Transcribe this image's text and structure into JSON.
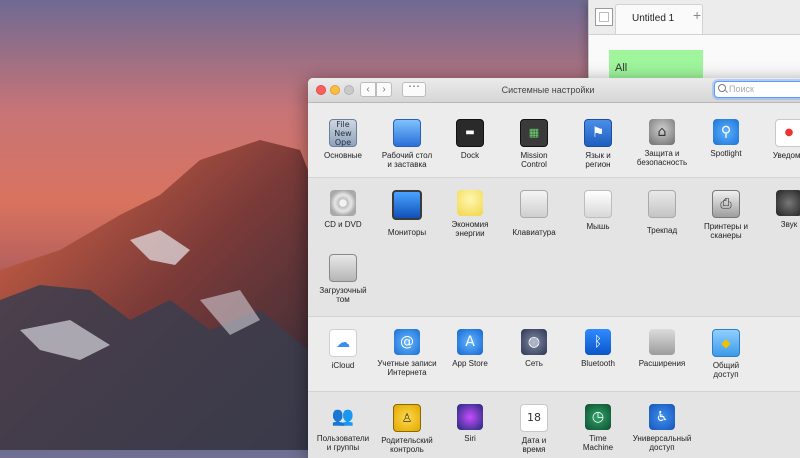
{
  "background_window": {
    "tab_title": "Untitled 1",
    "new_tab": "+",
    "cell_value": "All"
  },
  "window": {
    "title": "Системные настройки",
    "search_placeholder": "Поиск",
    "nav_back": "‹",
    "nav_forward": "›"
  },
  "panes": {
    "general": "Основные",
    "desktop": "Рабочий стол\nи заставка",
    "dock": "Dock",
    "mission": "Mission\nControl",
    "lang": "Язык и\nрегион",
    "security": "Защита и\nбезопасность",
    "spotlight": "Spotlight",
    "notify": "Уведомл",
    "cd": "CD и DVD",
    "monitors": "Мониторы",
    "energy": "Экономия\nэнергии",
    "keyboard": "Клавиатура",
    "mouse": "Мышь",
    "trackpad": "Трекпад",
    "printers": "Принтеры и\nсканеры",
    "sound": "Звук",
    "startup": "Загрузочный\nтом",
    "icloud": "iCloud",
    "internet": "Учетные записи\nИнтернета",
    "appstore": "App Store",
    "network": "Сеть",
    "bluetooth": "Bluetooth",
    "extensions": "Расширения",
    "shared": "Общий\nдоступ",
    "users": "Пользователи\nи группы",
    "parental": "Родительский\nконтроль",
    "siri": "Siri",
    "datetime": "Дата и\nвремя",
    "timemachine": "Time\nMachine",
    "access": "Универсальный\nдоступ"
  },
  "colors": {
    "cell_highlight": "#9ef59c",
    "search_focus": "#5a9bff",
    "close": "#fc605c",
    "minimize": "#fdbc40"
  }
}
